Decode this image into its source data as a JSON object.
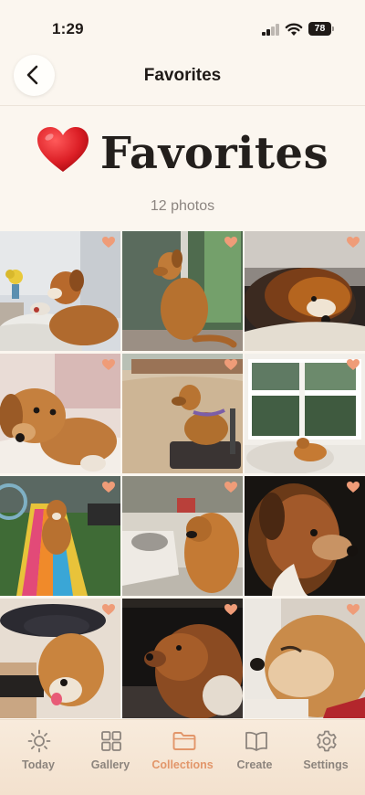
{
  "status": {
    "time": "1:29",
    "battery": "78"
  },
  "nav": {
    "title": "Favorites"
  },
  "header": {
    "title": "Favorites",
    "count": "12 photos"
  },
  "colors": {
    "accent": "#e2966a",
    "background": "#fbf6ef",
    "heart": "#d81e24"
  },
  "grid": {
    "photos": 12
  },
  "tabs": [
    {
      "label": "Today",
      "icon": "sun-icon"
    },
    {
      "label": "Gallery",
      "icon": "grid-icon"
    },
    {
      "label": "Collections",
      "icon": "folder-icon",
      "active": true
    },
    {
      "label": "Create",
      "icon": "book-icon"
    },
    {
      "label": "Settings",
      "icon": "gear-icon"
    }
  ]
}
